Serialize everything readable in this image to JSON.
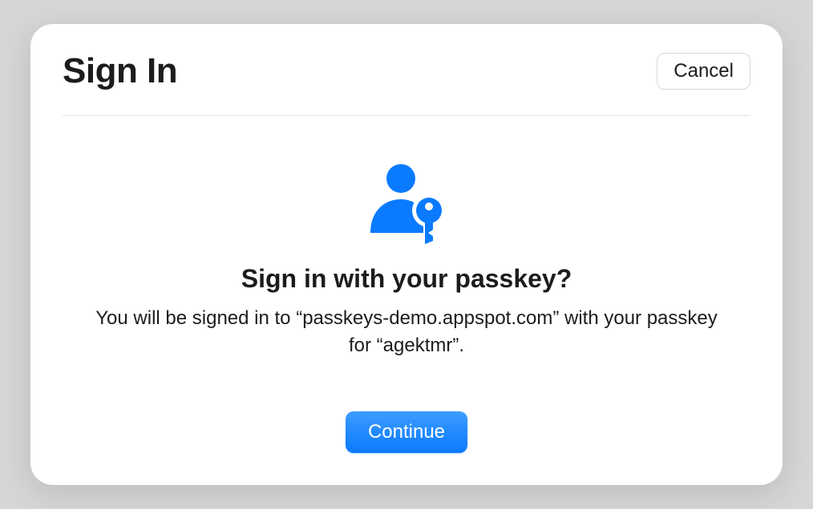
{
  "dialog": {
    "title": "Sign In",
    "cancel_label": "Cancel",
    "subtitle": "Sign in with your passkey?",
    "description": "You will be signed in to “passkeys-demo.appspot.com” with your passkey for “agektmr”.",
    "continue_label": "Continue",
    "icon_name": "passkey-icon",
    "accent_color": "#0a7aff"
  }
}
